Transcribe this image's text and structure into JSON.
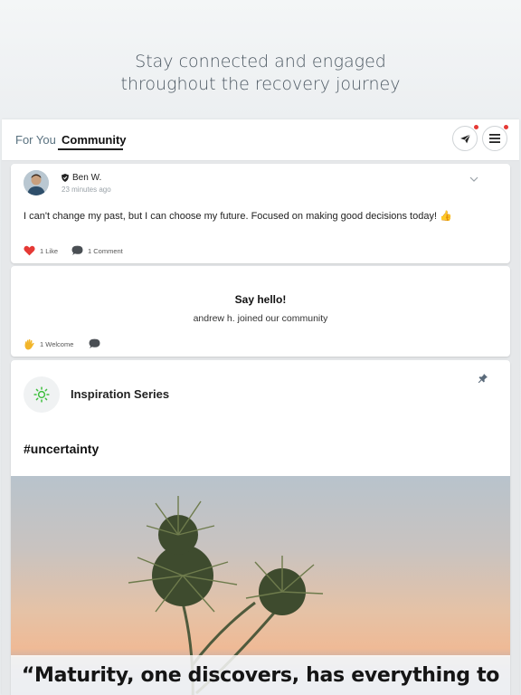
{
  "promo": {
    "line1": "Stay connected and engaged",
    "line2": "throughout the recovery journey"
  },
  "nav": {
    "tabs": [
      {
        "label": "For You",
        "active": false
      },
      {
        "label": "Community",
        "active": true
      }
    ],
    "send_icon": "paper-plane-icon",
    "menu_icon": "hamburger-menu-icon",
    "badge_color": "#e53935"
  },
  "post": {
    "author": "Ben W.",
    "time": "23 minutes ago",
    "text": "I can't change my past, but I can choose my future. Focused on making good decisions today! 👍",
    "likes": "1 Like",
    "comments": "1 Comment",
    "like_color": "#e53935"
  },
  "welcome": {
    "title": "Say hello!",
    "subtitle": "andrew h. joined our community",
    "welcomes": "1 Welcome"
  },
  "series": {
    "title": "Inspiration Series",
    "hashtag": "#uncertainty",
    "quote": "“Maturity, one discovers, has everything to",
    "accent": "#3fbf3f"
  }
}
